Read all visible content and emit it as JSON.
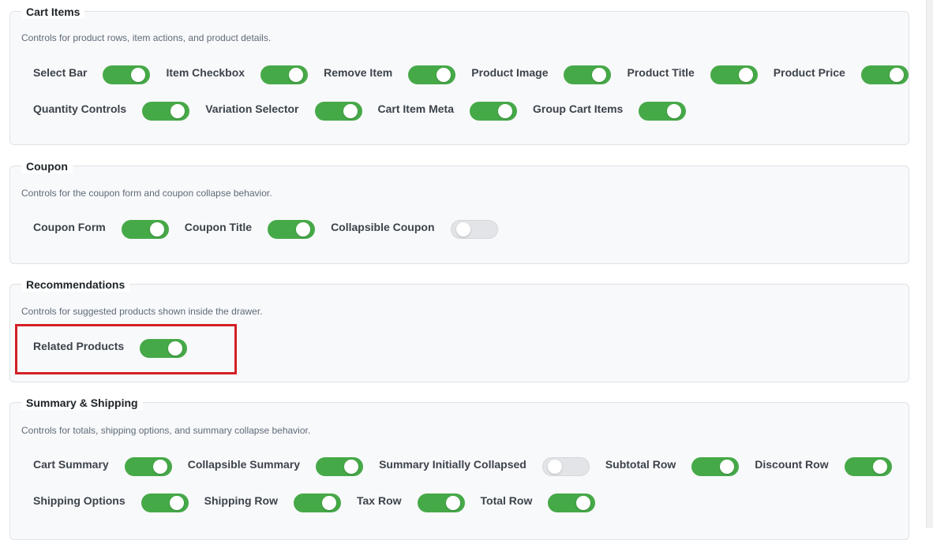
{
  "sections": [
    {
      "title": "Cart Items",
      "description": "Controls for product rows, item actions, and product details.",
      "rows": [
        [
          {
            "label": "Select Bar",
            "on": true
          },
          {
            "label": "Item Checkbox",
            "on": true
          },
          {
            "label": "Remove Item",
            "on": true
          },
          {
            "label": "Product Image",
            "on": true
          },
          {
            "label": "Product Title",
            "on": true
          },
          {
            "label": "Product Price",
            "on": true
          }
        ],
        [
          {
            "label": "Quantity Controls",
            "on": true
          },
          {
            "label": "Variation Selector",
            "on": true
          },
          {
            "label": "Cart Item Meta",
            "on": true
          },
          {
            "label": "Group Cart Items",
            "on": true
          }
        ]
      ]
    },
    {
      "title": "Coupon",
      "description": "Controls for the coupon form and coupon collapse behavior.",
      "rows": [
        [
          {
            "label": "Coupon Form",
            "on": true
          },
          {
            "label": "Coupon Title",
            "on": true
          },
          {
            "label": "Collapsible Coupon",
            "on": false
          }
        ]
      ]
    },
    {
      "title": "Recommendations",
      "description": "Controls for suggested products shown inside the drawer.",
      "rows": [
        [
          {
            "label": "Related Products",
            "on": true
          }
        ]
      ]
    },
    {
      "title": "Summary & Shipping",
      "description": "Controls for totals, shipping options, and summary collapse behavior.",
      "rows": [
        [
          {
            "label": "Cart Summary",
            "on": true
          },
          {
            "label": "Collapsible Summary",
            "on": true
          },
          {
            "label": "Summary Initially Collapsed",
            "on": false
          },
          {
            "label": "Subtotal Row",
            "on": true
          },
          {
            "label": "Discount Row",
            "on": true
          }
        ],
        [
          {
            "label": "Shipping Options",
            "on": true
          },
          {
            "label": "Shipping Row",
            "on": true
          },
          {
            "label": "Tax Row",
            "on": true
          },
          {
            "label": "Total Row",
            "on": true
          }
        ]
      ]
    }
  ],
  "colors": {
    "toggle_on": "#46a948",
    "toggle_off": "#e2e4e7",
    "highlight": "#d32026"
  }
}
